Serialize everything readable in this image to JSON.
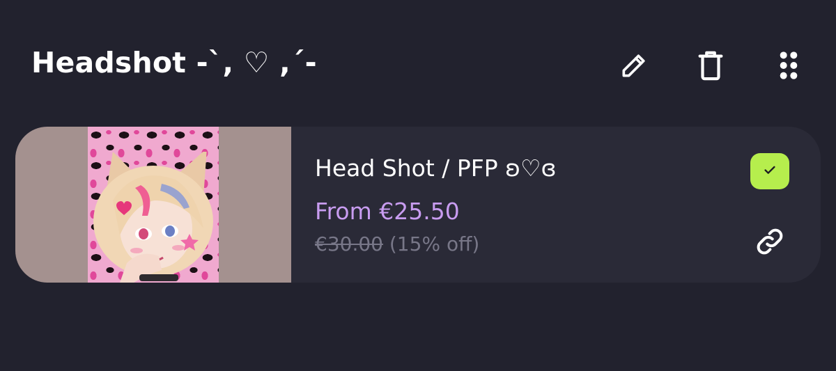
{
  "section": {
    "title": "Headshot  -`, ♡ ,´-"
  },
  "toolbar": {
    "edit_icon": "pencil-icon",
    "delete_icon": "trash-icon",
    "drag_icon": "drag-handle-icon"
  },
  "product": {
    "title": "Head Shot / PFP ʚ♡ɞ",
    "price": "From €25.50",
    "original_price": "€30.00",
    "discount": " (15% off)",
    "image_desc": "anime-headshot-thumbnail",
    "selected": true,
    "link_icon": "link-icon"
  },
  "colors": {
    "background": "#22222e",
    "card": "#2a2a37",
    "price_accent": "#c89cf0",
    "check_badge": "#b6ee4d",
    "muted_text": "#787788"
  }
}
